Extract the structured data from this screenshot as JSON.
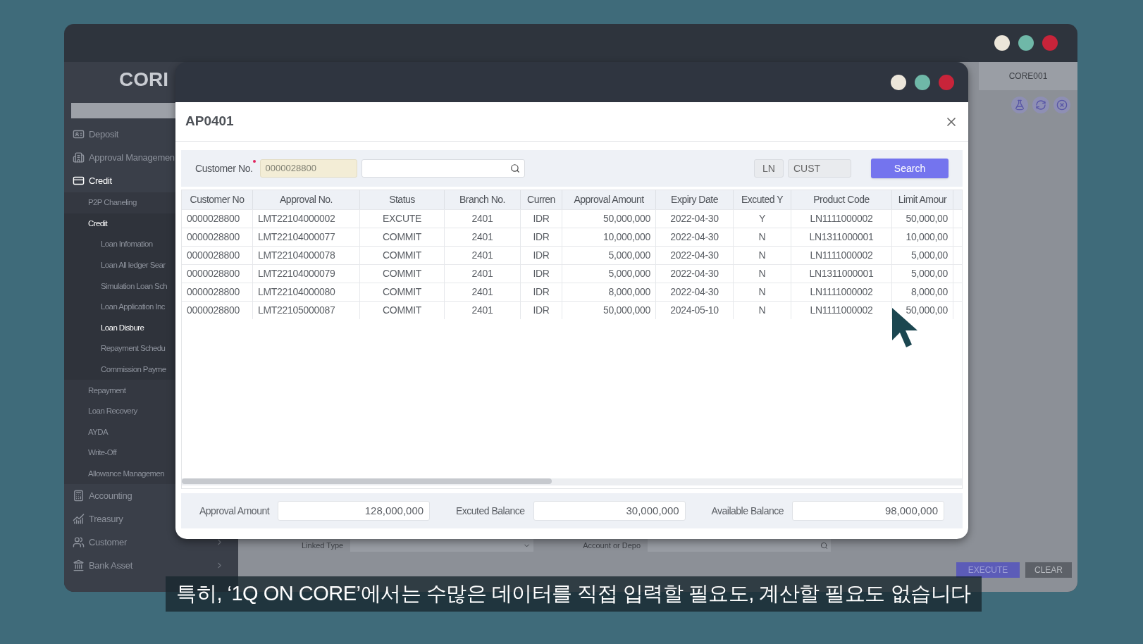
{
  "back_window": {
    "logo": "CORI",
    "tab": "CORE001",
    "linked_type_label": "Linked Type",
    "account_label": "Account or Depo",
    "buttons": [
      "EXECUTE",
      "CLEAR"
    ]
  },
  "sidebar": {
    "items": [
      {
        "label": "Deposit",
        "selected": false
      },
      {
        "label": "Approval Managemen",
        "selected": false
      },
      {
        "label": "Credit",
        "selected": true,
        "children": [
          {
            "label": "P2P Chaneling",
            "selected": false
          },
          {
            "label": "Credit",
            "selected": true,
            "children": [
              {
                "label": "Loan Infomation",
                "selected": false
              },
              {
                "label": "Loan All ledger Sear",
                "selected": false
              },
              {
                "label": "Simulation Loan Sch",
                "selected": false
              },
              {
                "label": "Loan Application Inc",
                "selected": false
              },
              {
                "label": "Loan Disbure",
                "selected": true
              },
              {
                "label": "Repayment Schedu",
                "selected": false
              },
              {
                "label": "Commission Payme",
                "selected": false
              }
            ]
          },
          {
            "label": "Repayment",
            "selected": false
          },
          {
            "label": "Loan Recovery",
            "selected": false
          },
          {
            "label": "AYDA",
            "selected": false
          },
          {
            "label": "Write-Off",
            "selected": false
          },
          {
            "label": "Allowance Managemen",
            "selected": false
          }
        ]
      },
      {
        "label": "Accounting",
        "selected": false
      },
      {
        "label": "Treasury",
        "selected": false
      },
      {
        "label": "Customer",
        "selected": false
      },
      {
        "label": "Bank Asset",
        "selected": false
      }
    ]
  },
  "dialog": {
    "title": "AP0401",
    "filter": {
      "label": "Customer No.",
      "value": "0000028800",
      "type": "LN",
      "kind": "CUST",
      "button": "Search"
    },
    "table": {
      "columns": [
        "Customer No",
        "Approval No.",
        "Status",
        "Branch No.",
        "Curren",
        "Approval Amount",
        "Expiry Date",
        "Excuted Y",
        "Product Code",
        "Limit Amour"
      ],
      "rows": [
        [
          "0000028800",
          "LMT22104000002",
          "EXCUTE",
          "2401",
          "IDR",
          "50,000,000",
          "2022-04-30",
          "Y",
          "LN1111000002",
          "50,000,00"
        ],
        [
          "0000028800",
          "LMT22104000077",
          "COMMIT",
          "2401",
          "IDR",
          "10,000,000",
          "2022-04-30",
          "N",
          "LN1311000001",
          "10,000,00"
        ],
        [
          "0000028800",
          "LMT22104000078",
          "COMMIT",
          "2401",
          "IDR",
          "5,000,000",
          "2022-04-30",
          "N",
          "LN1111000002",
          "5,000,00"
        ],
        [
          "0000028800",
          "LMT22104000079",
          "COMMIT",
          "2401",
          "IDR",
          "5,000,000",
          "2022-04-30",
          "N",
          "LN1311000001",
          "5,000,00"
        ],
        [
          "0000028800",
          "LMT22104000080",
          "COMMIT",
          "2401",
          "IDR",
          "8,000,000",
          "2022-04-30",
          "N",
          "LN1111000002",
          "8,000,00"
        ],
        [
          "0000028800",
          "LMT22105000087",
          "COMMIT",
          "2401",
          "IDR",
          "50,000,000",
          "2024-05-10",
          "N",
          "LN1111000002",
          "50,000,00"
        ]
      ]
    },
    "totals": [
      {
        "label": "Approval Amount",
        "value": "128,000,000"
      },
      {
        "label": "Excuted Balance",
        "value": "30,000,000"
      },
      {
        "label": "Available Balance",
        "value": "98,000,000"
      }
    ]
  },
  "subtitle": "특히, ‘1Q ON CORE’에서는 수많은 데이터를 직접 입력할 필요도, 계산할 필요도 없습니다"
}
